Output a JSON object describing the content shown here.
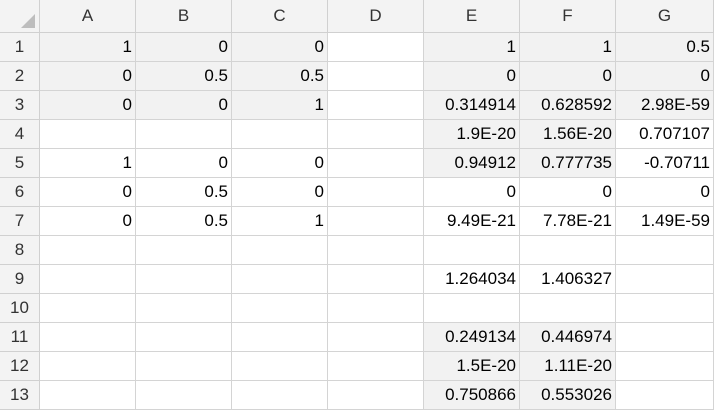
{
  "columns": [
    "A",
    "B",
    "C",
    "D",
    "E",
    "F",
    "G"
  ],
  "rows": [
    {
      "num": "1",
      "cells": [
        "1",
        "0",
        "0",
        "",
        "1",
        "1",
        "0.5"
      ]
    },
    {
      "num": "2",
      "cells": [
        "0",
        "0.5",
        "0.5",
        "",
        "0",
        "0",
        "0"
      ]
    },
    {
      "num": "3",
      "cells": [
        "0",
        "0",
        "1",
        "",
        "0.314914",
        "0.628592",
        "2.98E-59"
      ]
    },
    {
      "num": "4",
      "cells": [
        "",
        "",
        "",
        "",
        "1.9E-20",
        "1.56E-20",
        "0.707107"
      ]
    },
    {
      "num": "5",
      "cells": [
        "1",
        "0",
        "0",
        "",
        "0.94912",
        "0.777735",
        "-0.70711"
      ]
    },
    {
      "num": "6",
      "cells": [
        "0",
        "0.5",
        "0",
        "",
        "0",
        "0",
        "0"
      ]
    },
    {
      "num": "7",
      "cells": [
        "0",
        "0.5",
        "1",
        "",
        "9.49E-21",
        "7.78E-21",
        "1.49E-59"
      ]
    },
    {
      "num": "8",
      "cells": [
        "",
        "",
        "",
        "",
        "",
        "",
        ""
      ]
    },
    {
      "num": "9",
      "cells": [
        "",
        "",
        "",
        "",
        "1.264034",
        "1.406327",
        ""
      ]
    },
    {
      "num": "10",
      "cells": [
        "",
        "",
        "",
        "",
        "",
        "",
        ""
      ]
    },
    {
      "num": "11",
      "cells": [
        "",
        "",
        "",
        "",
        "0.249134",
        "0.446974",
        ""
      ]
    },
    {
      "num": "12",
      "cells": [
        "",
        "",
        "",
        "",
        "1.5E-20",
        "1.11E-20",
        ""
      ]
    },
    {
      "num": "13",
      "cells": [
        "",
        "",
        "",
        "",
        "0.750866",
        "0.553026",
        ""
      ]
    }
  ],
  "shaded_cells": [
    "0-0",
    "0-1",
    "0-2",
    "1-0",
    "1-1",
    "1-2",
    "2-0",
    "2-1",
    "2-2",
    "0-4",
    "0-5",
    "0-6",
    "1-4",
    "1-5",
    "1-6",
    "2-4",
    "2-5",
    "2-6",
    "3-4",
    "3-5",
    "4-4",
    "4-5",
    "10-4",
    "10-5",
    "11-4",
    "11-5",
    "12-4",
    "12-5"
  ],
  "colors": {
    "shade": "#f2f2f2",
    "gridline": "#d4d4d4",
    "header_bg": "#f3f3f3"
  }
}
